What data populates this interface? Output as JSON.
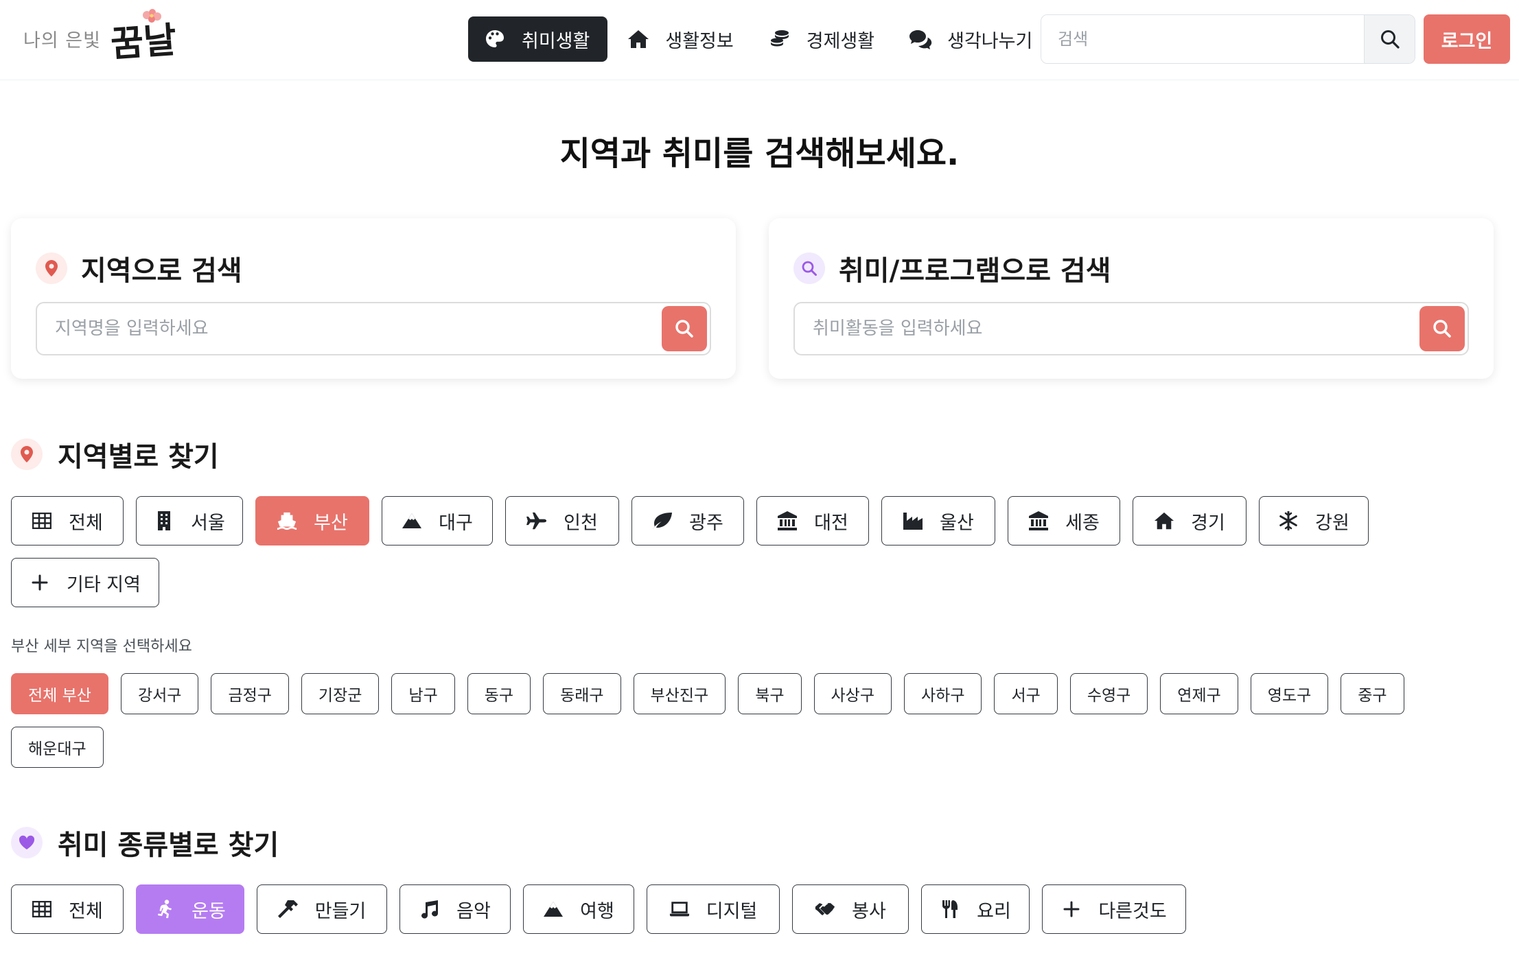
{
  "header": {
    "logo_small": "나의 은빛",
    "logo_big": "꿈날",
    "nav": [
      {
        "label": "취미생활",
        "icon": "palette-icon",
        "active": true
      },
      {
        "label": "생활정보",
        "icon": "home-icon",
        "active": false
      },
      {
        "label": "경제생활",
        "icon": "coins-icon",
        "active": false
      },
      {
        "label": "생각나누기",
        "icon": "comments-icon",
        "active": false
      }
    ],
    "search_placeholder": "검색",
    "login_label": "로그인"
  },
  "page_title": "지역과 취미를 검색해보세요.",
  "region_search": {
    "title": "지역으로 검색",
    "placeholder": "지역명을 입력하세요"
  },
  "hobby_search": {
    "title": "취미/프로그램으로 검색",
    "placeholder": "취미활동을 입력하세요"
  },
  "region_section": {
    "title": "지역별로 찾기",
    "regions": [
      {
        "label": "전체",
        "icon": "table-icon",
        "active": false
      },
      {
        "label": "서울",
        "icon": "building-icon",
        "active": false
      },
      {
        "label": "부산",
        "icon": "ship-icon",
        "active": true
      },
      {
        "label": "대구",
        "icon": "mountain-icon",
        "active": false
      },
      {
        "label": "인천",
        "icon": "plane-icon",
        "active": false
      },
      {
        "label": "광주",
        "icon": "leaf-icon",
        "active": false
      },
      {
        "label": "대전",
        "icon": "landmark-icon",
        "active": false
      },
      {
        "label": "울산",
        "icon": "industry-icon",
        "active": false
      },
      {
        "label": "세종",
        "icon": "landmark-icon",
        "active": false
      },
      {
        "label": "경기",
        "icon": "home-icon",
        "active": false
      },
      {
        "label": "강원",
        "icon": "snowflake-icon",
        "active": false
      },
      {
        "label": "기타 지역",
        "icon": "plus-icon",
        "active": false
      }
    ],
    "sub_label": "부산 세부 지역을 선택하세요",
    "districts": [
      {
        "label": "전체 부산",
        "active": true
      },
      {
        "label": "강서구",
        "active": false
      },
      {
        "label": "금정구",
        "active": false
      },
      {
        "label": "기장군",
        "active": false
      },
      {
        "label": "남구",
        "active": false
      },
      {
        "label": "동구",
        "active": false
      },
      {
        "label": "동래구",
        "active": false
      },
      {
        "label": "부산진구",
        "active": false
      },
      {
        "label": "북구",
        "active": false
      },
      {
        "label": "사상구",
        "active": false
      },
      {
        "label": "사하구",
        "active": false
      },
      {
        "label": "서구",
        "active": false
      },
      {
        "label": "수영구",
        "active": false
      },
      {
        "label": "연제구",
        "active": false
      },
      {
        "label": "영도구",
        "active": false
      },
      {
        "label": "중구",
        "active": false
      },
      {
        "label": "해운대구",
        "active": false
      }
    ]
  },
  "hobby_section": {
    "title": "취미 종류별로 찾기",
    "categories": [
      {
        "label": "전체",
        "icon": "table-icon",
        "active": false
      },
      {
        "label": "운동",
        "icon": "running-icon",
        "active": true
      },
      {
        "label": "만들기",
        "icon": "hammer-icon",
        "active": false
      },
      {
        "label": "음악",
        "icon": "music-icon",
        "active": false
      },
      {
        "label": "여행",
        "icon": "mountain-icon",
        "active": false
      },
      {
        "label": "디지털",
        "icon": "laptop-icon",
        "active": false
      },
      {
        "label": "봉사",
        "icon": "handshake-icon",
        "active": false
      },
      {
        "label": "요리",
        "icon": "utensils-icon",
        "active": false
      },
      {
        "label": "다른것도",
        "icon": "plus-icon",
        "active": false
      }
    ]
  },
  "colors": {
    "accent_red": "#e8736b",
    "accent_purple": "#b57cf2",
    "dark": "#212529"
  }
}
